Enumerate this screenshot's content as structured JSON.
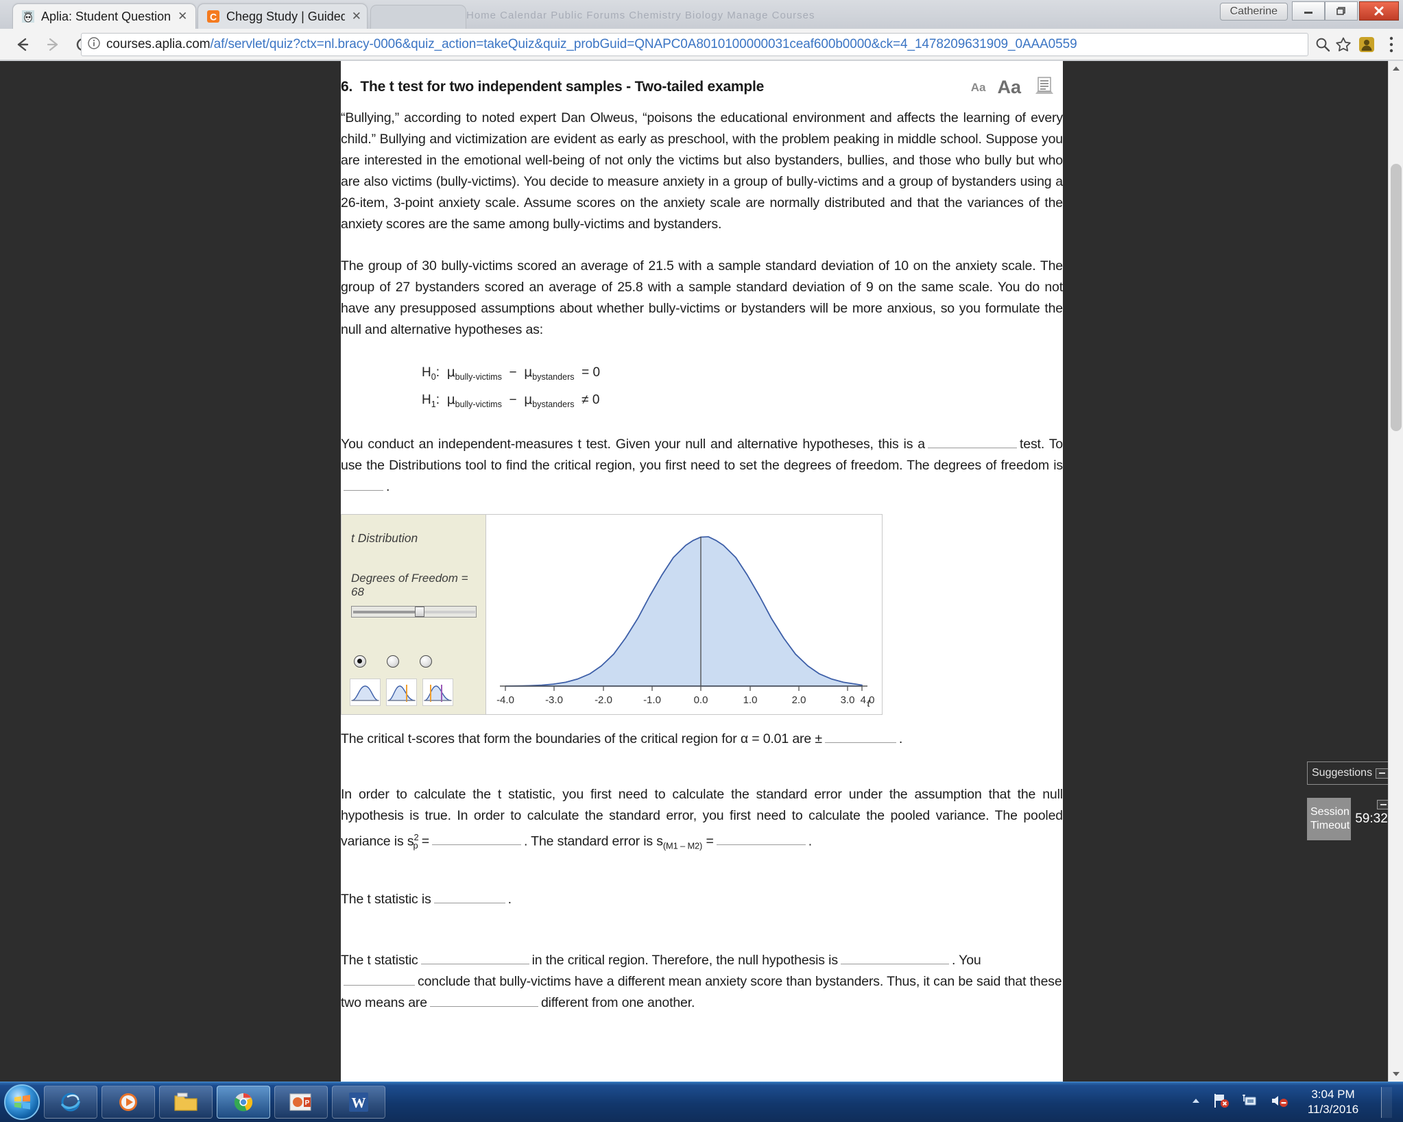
{
  "window": {
    "user_button": "Catherine",
    "minimize_label": "Minimize",
    "maximize_label": "Restore",
    "close_label": "Close"
  },
  "browser": {
    "tabs": [
      {
        "title": "Aplia: Student Question",
        "favicon": "aplia-owl-icon",
        "active": true,
        "close_label": "✕"
      },
      {
        "title": "Chegg Study | Guided So",
        "favicon": "chegg-c-icon",
        "active": false,
        "close_label": "✕"
      }
    ],
    "new_tab_label": "",
    "background_window_text": "Home  Calendar  Public Forums  Chemistry  Biology  Manage Courses",
    "nav": {
      "back_label": "Back",
      "forward_label": "Forward",
      "reload_label": "Reload"
    },
    "omnibox": {
      "host": "courses.aplia.com",
      "path": "/af/servlet/quiz?ctx=nl.bracy-0006&quiz_action=takeQuiz&quiz_probGuid=QNAPC0A8010100000031ceaf600b0000&ck=4_1478209631909_0AAA0559",
      "info_icon": "info-circle-icon",
      "search_icon": "search-icon",
      "bookmark_icon": "star-icon",
      "profile_icon": "user-avatar-icon",
      "menu_icon": "three-dots-vertical-icon"
    }
  },
  "question": {
    "number": "6.",
    "title": "The t test for two independent samples - Two-tailed example",
    "font_small_label": "Aa",
    "font_large_label": "Aa",
    "print_icon": "print-icon",
    "paragraph1": "“Bullying,” according to noted expert Dan Olweus, “poisons the educational environment and affects the learning of every child.” Bullying and victimization are evident as early as preschool, with the problem peaking in middle school. Suppose you are interested in the emotional well-being of not only the victims but also bystanders, bullies, and those who bully but who are also victims (bully-victims). You decide to measure anxiety in a group of bully-victims and a group of bystanders using a 26-item, 3-point anxiety scale. Assume scores on the anxiety scale are normally distributed and that the variances of the anxiety scores are the same among bully-victims and bystanders.",
    "paragraph2": "The group of 30 bully-victims scored an average of 21.5 with a sample standard deviation of 10 on the anxiety scale. The group of 27 bystanders scored an average of 25.8 with a sample standard deviation of 9 on the same scale. You do not have any presupposed assumptions about whether bully-victims or bystanders will be more anxious, so you formulate the null and alternative hypotheses as:",
    "hypotheses": [
      {
        "name": "H",
        "sub": "0",
        "expr": "μ",
        "g1": "bully-victims",
        "op": "−",
        "expr2": "μ",
        "g2": "bystanders",
        "rel": "=",
        "value": "0"
      },
      {
        "name": "H",
        "sub": "1",
        "expr": "μ",
        "g1": "bully-victims",
        "op": "−",
        "expr2": "μ",
        "g2": "bystanders",
        "rel": "≠",
        "value": "0"
      }
    ],
    "paragraph3_a": "You conduct an independent-measures t test. Given your null and alternative hypotheses, this is a",
    "paragraph3_b": "test. To use the Distributions tool to find the critical region, you first need to set the degrees of freedom. The degrees of freedom is",
    "paragraph3_c": ".",
    "critical_a": "The critical t-scores that form the boundaries of the critical region for α = 0.01 are ±",
    "critical_b": ".",
    "pooled_a": "In order to calculate the t statistic, you first need to calculate the standard error under the assumption that the null hypothesis is true. In order to calculate the standard error, you first need to calculate the pooled variance. The pooled variance is s",
    "pooled_sup": "2",
    "pooled_sub": "p",
    "pooled_eq": "=",
    "pooled_b": ". The standard error is s",
    "pooled_se_sub": "(M1 – M2)",
    "pooled_se_eq": "=",
    "pooled_c": ".",
    "tstat_a": "The t statistic is",
    "tstat_b": ".",
    "conclusion_a": "The t statistic",
    "conclusion_b": "in the critical region. Therefore, the null hypothesis is",
    "conclusion_c": ". You",
    "conclusion_d": "conclude that bully-victims have a different mean anxiety score than bystanders. Thus, it can be said that these two means are",
    "conclusion_e": "different from one another."
  },
  "dist_tool": {
    "title": "t Distribution",
    "df_label": "Degrees of Freedom = 68",
    "slider_name": "degrees-of-freedom-slider",
    "tail_options": [
      {
        "name": "no-tail",
        "selected": true
      },
      {
        "name": "one-tail",
        "selected": false
      },
      {
        "name": "two-tail",
        "selected": false
      }
    ]
  },
  "chart_data": {
    "type": "line",
    "title": "t Distribution",
    "xlabel": "t",
    "ylabel": "",
    "xlim": [
      -4.0,
      4.0
    ],
    "ylim": [
      0,
      0.4
    ],
    "grid": false,
    "legend": null,
    "tick_labels": [
      "-4.0",
      "-3.0",
      "-2.0",
      "-1.0",
      "0.0",
      "1.0",
      "2.0",
      "3.0",
      "4.0"
    ],
    "x": [
      -4.0,
      -3.5,
      -3.0,
      -2.5,
      -2.0,
      -1.5,
      -1.0,
      -0.5,
      0.0,
      0.5,
      1.0,
      1.5,
      2.0,
      2.5,
      3.0,
      3.5,
      4.0
    ],
    "values": [
      0.0002,
      0.0009,
      0.0044,
      0.0175,
      0.054,
      0.1295,
      0.242,
      0.3521,
      0.3989,
      0.3521,
      0.242,
      0.1295,
      0.054,
      0.0175,
      0.0044,
      0.0009,
      0.0002
    ],
    "fill_color": "#cdddf2",
    "line_color": "#3d5fa8",
    "center_line_x": 0.0,
    "degrees_of_freedom": 68,
    "annotation": "Shaded t distribution with vertical center line at t = 0.0"
  },
  "aplia_widgets": {
    "suggestions_label": "Suggestions",
    "suggestions_minimize": "minimize-icon",
    "timeout_label": "Session Timeout",
    "timeout_value": "59:32",
    "timeout_minimize": "minimize-icon"
  },
  "taskbar": {
    "start_label": "Start",
    "items": [
      {
        "name": "internet-explorer",
        "icon": "ie-icon"
      },
      {
        "name": "media-player",
        "icon": "play-icon"
      },
      {
        "name": "file-explorer",
        "icon": "folder-icon"
      },
      {
        "name": "google-chrome",
        "icon": "chrome-icon"
      },
      {
        "name": "powerpoint",
        "icon": "powerpoint-icon"
      },
      {
        "name": "word",
        "icon": "word-icon"
      }
    ],
    "tray": {
      "show_hidden_icon": "chevron-up-icon",
      "network_icon": "network-flag-error-icon",
      "action_center_icon": "action-center-icon",
      "volume_icon": "volume-muted-icon"
    },
    "clock_time": "3:04 PM",
    "clock_date": "11/3/2016"
  }
}
